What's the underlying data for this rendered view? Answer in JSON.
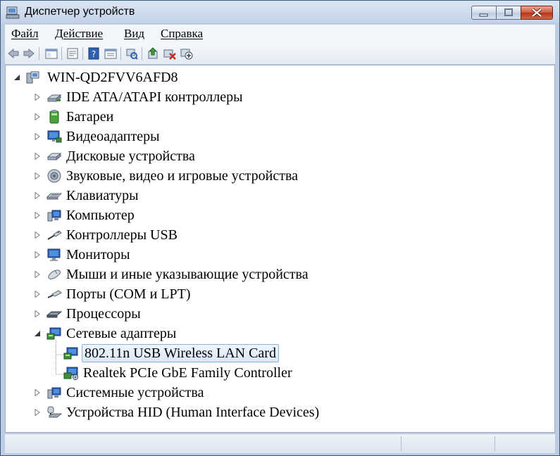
{
  "window": {
    "title": "Диспетчер устройств"
  },
  "menu": [
    {
      "label": "Файл"
    },
    {
      "label": "Действие"
    },
    {
      "label": "Вид"
    },
    {
      "label": "Справка"
    }
  ],
  "toolbar": {
    "buttons": [
      "back-arrow-icon",
      "forward-arrow-icon",
      "show-hide-tree-icon",
      "properties-icon",
      "help-icon",
      "action-pane-icon",
      "scan-hardware-icon",
      "update-driver-icon",
      "uninstall-icon",
      "disable-device-icon"
    ]
  },
  "tree": {
    "root": "WIN-QD2FVV6AFD8",
    "categories": [
      {
        "label": "IDE ATA/ATAPI контроллеры",
        "icon": "ide-controller-icon",
        "expanded": false
      },
      {
        "label": "Батареи",
        "icon": "battery-icon",
        "expanded": false
      },
      {
        "label": "Видеоадаптеры",
        "icon": "display-adapter-icon",
        "expanded": false
      },
      {
        "label": "Дисковые устройства",
        "icon": "disk-drive-icon",
        "expanded": false
      },
      {
        "label": "Звуковые, видео и игровые устройства",
        "icon": "speaker-icon",
        "expanded": false
      },
      {
        "label": "Клавиатуры",
        "icon": "keyboard-icon",
        "expanded": false
      },
      {
        "label": "Компьютер",
        "icon": "computer-icon",
        "expanded": false
      },
      {
        "label": "Контроллеры USB",
        "icon": "usb-icon",
        "expanded": false
      },
      {
        "label": "Мониторы",
        "icon": "monitor-icon",
        "expanded": false
      },
      {
        "label": "Мыши и иные указывающие устройства",
        "icon": "mouse-icon",
        "expanded": false
      },
      {
        "label": "Порты (COM и LPT)",
        "icon": "port-icon",
        "expanded": false
      },
      {
        "label": "Процессоры",
        "icon": "processor-icon",
        "expanded": false
      },
      {
        "label": "Сетевые адаптеры",
        "icon": "network-adapter-icon",
        "expanded": true,
        "children": [
          {
            "label": "802.11n USB Wireless LAN Card",
            "icon": "network-adapter-icon",
            "selected": true
          },
          {
            "label": "Realtek PCIe GbE Family Controller",
            "icon": "network-adapter-icon",
            "selected": false
          }
        ]
      },
      {
        "label": "Системные устройства",
        "icon": "system-device-icon",
        "expanded": false
      },
      {
        "label": "Устройства HID (Human Interface Devices)",
        "icon": "hid-icon",
        "expanded": false
      }
    ]
  },
  "colors": {
    "selection_border": "#8cb4e2",
    "selection_fill": "#dde9f9",
    "frame": "#bccde3"
  }
}
